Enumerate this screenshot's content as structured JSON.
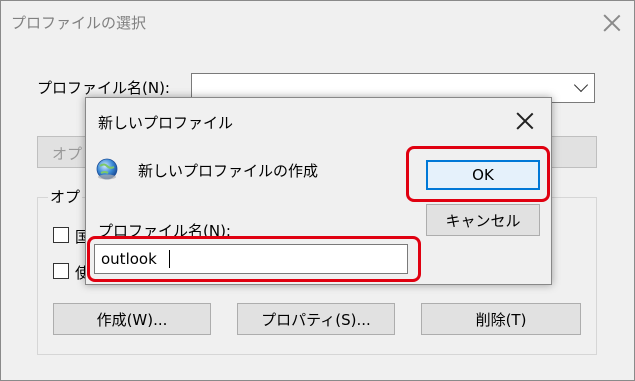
{
  "parent_window": {
    "title": "プロファイルの選択",
    "profile_label": "プロファイル名(N):",
    "options_button_label": "オプ",
    "options_group_label": "オプ",
    "checkbox1_label": "国",
    "checkbox2_label": "使",
    "create_button": "作成(W)...",
    "properties_button": "プロパティ(S)...",
    "delete_button": "削除(T)"
  },
  "dialog": {
    "title": "新しいプロファイル",
    "heading": "新しいプロファイルの作成",
    "profile_name_label": "プロファイル名(N):",
    "profile_name_value": "outlook",
    "ok_label": "OK",
    "cancel_label": "キャンセル"
  },
  "colors": {
    "highlight": "#e00010",
    "ok_border": "#0078d7"
  }
}
